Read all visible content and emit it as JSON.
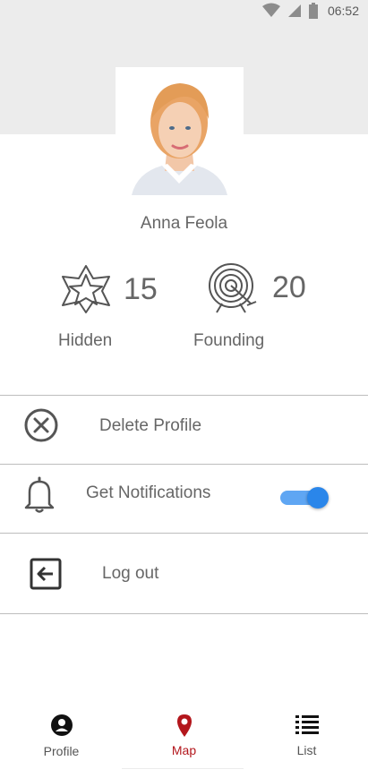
{
  "status_bar": {
    "time": "06:52"
  },
  "profile": {
    "name": "Anna Feola"
  },
  "stats": [
    {
      "value": "15",
      "label": "Hidden",
      "icon": "star-icon"
    },
    {
      "value": "20",
      "label": "Founding",
      "icon": "target-icon"
    }
  ],
  "menu": {
    "delete_label": "Delete Profile",
    "notifications_label": "Get Notifications",
    "notifications_enabled": true,
    "logout_label": "Log out"
  },
  "bottom_nav": {
    "items": [
      {
        "label": "Profile",
        "icon": "user-circle-icon",
        "active": false
      },
      {
        "label": "Map",
        "icon": "map-pin-icon",
        "active": true
      },
      {
        "label": "List",
        "icon": "list-icon",
        "active": false
      }
    ]
  },
  "colors": {
    "accent": "#b3161c",
    "toggle": "#2a86ea",
    "text": "#666666",
    "header": "#ececec"
  }
}
